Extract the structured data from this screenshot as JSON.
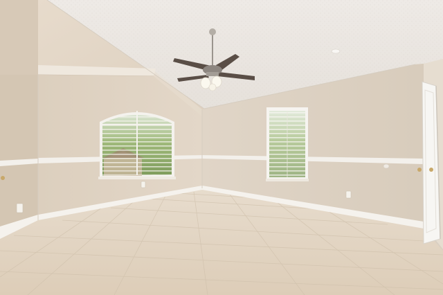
{
  "palette": {
    "ceiling": "#ebe7e2",
    "wall_left": "#e0d4c4",
    "wall_back": "#ddd1c2",
    "floor": "#e3d6c5",
    "trim": "#f4f1ec",
    "window_view": "#9bb574",
    "fan_blade": "#5a4e46",
    "door": "#f7f6f3"
  },
  "icons": [
    "ceiling-fan-icon",
    "light-bulb-icon",
    "electrical-outlet-icon",
    "door-knob-icon"
  ]
}
